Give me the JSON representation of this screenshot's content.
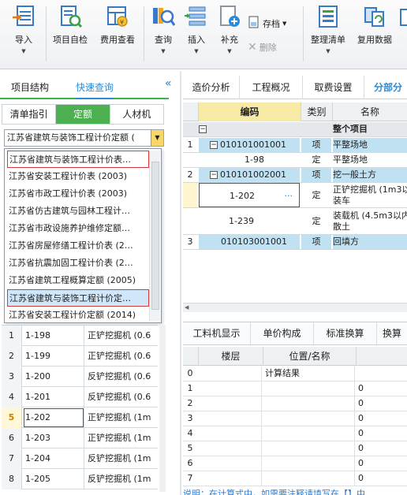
{
  "toolbar": {
    "import": "导入",
    "self_check": "项目自检",
    "fee_view": "费用查看",
    "query": "查询",
    "insert": "插入",
    "supplement": "补充",
    "save_file": "存档",
    "delete": "删除",
    "organize_list": "整理清单",
    "reuse_data": "复用数据"
  },
  "left_panel": {
    "tabs": [
      "项目结构",
      "快速查询"
    ],
    "active_tab": "快速查询",
    "sub_tabs": [
      "清单指引",
      "定额",
      "人材机"
    ],
    "active_sub_tab": "定额",
    "combo_value": "江苏省建筑与装饰工程计价定额 (",
    "dropdown_items": [
      "江苏省建筑与装饰工程计价表…",
      "江苏省安装工程计价表 (2003)",
      "江苏省市政工程计价表 (2003)",
      "江苏省仿古建筑与园林工程计…",
      "江苏省市政设施养护维修定额…",
      "江苏省房屋修缮工程计价表 (2…",
      "江苏省抗震加固工程计价表 (2…",
      "江苏省建筑工程概算定额 (2005)",
      "江苏省建筑与装饰工程计价定…",
      "江苏省安装工程计价定额 (2014)"
    ],
    "rows": [
      {
        "n": "1",
        "code": "1-198",
        "desc": "正铲挖掘机 (0.6"
      },
      {
        "n": "2",
        "code": "1-199",
        "desc": "正铲挖掘机 (0.6"
      },
      {
        "n": "3",
        "code": "1-200",
        "desc": "反铲挖掘机 (0.6"
      },
      {
        "n": "4",
        "code": "1-201",
        "desc": "反铲挖掘机 (0.6"
      },
      {
        "n": "5",
        "code": "1-202",
        "desc": "正铲挖掘机 (1m"
      },
      {
        "n": "6",
        "code": "1-203",
        "desc": "正铲挖掘机 (1m"
      },
      {
        "n": "7",
        "code": "1-204",
        "desc": "反铲挖掘机 (1m"
      },
      {
        "n": "8",
        "code": "1-205",
        "desc": "反铲挖掘机 (1m"
      }
    ]
  },
  "right_panel": {
    "tabs": [
      "造价分析",
      "工程概况",
      "取费设置",
      "分部分"
    ],
    "active_tab": "分部分",
    "columns": {
      "code": "编码",
      "type": "类别",
      "name": "名称"
    },
    "root_name": "整个项目",
    "rows": [
      {
        "n": "1",
        "code": "010101001001",
        "type": "项",
        "name": "平整场地"
      },
      {
        "n": "",
        "code": "1-98",
        "type": "定",
        "name": "平整场地"
      },
      {
        "n": "2",
        "code": "010101002001",
        "type": "项",
        "name": "挖一般土方"
      },
      {
        "n": "",
        "code": "1-202",
        "type": "定",
        "name": "正铲挖掘机 (1m3以",
        "name2": "装车"
      },
      {
        "n": "",
        "code": "1-239",
        "type": "定",
        "name": "装载机 (4.5m3以内",
        "name2": "散土"
      },
      {
        "n": "3",
        "code": "010103001001",
        "type": "项",
        "name": "回填方"
      }
    ],
    "more_btn": "···",
    "bottom_tabs": [
      "工料机显示",
      "单价构成",
      "标准换算",
      "换算"
    ],
    "bottom_columns": {
      "floor": "楼层",
      "position": "位置/名称"
    },
    "bottom_rows": [
      {
        "n": "0",
        "pos": "计算结果",
        "val": ""
      },
      {
        "n": "1",
        "pos": "",
        "val": "0"
      },
      {
        "n": "2",
        "pos": "",
        "val": "0"
      },
      {
        "n": "3",
        "pos": "",
        "val": "0"
      },
      {
        "n": "4",
        "pos": "",
        "val": "0"
      },
      {
        "n": "5",
        "pos": "",
        "val": "0"
      },
      {
        "n": "6",
        "pos": "",
        "val": "0"
      },
      {
        "n": "7",
        "pos": "",
        "val": "0"
      }
    ],
    "note": "说明：在计算式中，如需要注释请填写在【】中"
  },
  "colors": {
    "accent": "#2a8cd8",
    "green_tab": "#4caf50",
    "row_highlight": "#bfe1f2",
    "header_code": "#f7e9a6",
    "red_outline": "#d23c3c"
  }
}
